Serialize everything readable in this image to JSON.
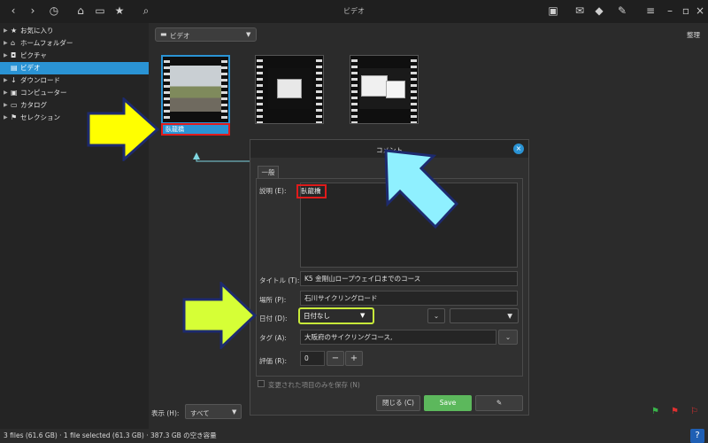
{
  "window": {
    "title": "ビデオ"
  },
  "sidebar": {
    "items": [
      {
        "label": "お気に入り",
        "icon": "star-icon",
        "glyph": "★"
      },
      {
        "label": "ホームフォルダー",
        "icon": "home-icon",
        "glyph": "⌂"
      },
      {
        "label": "ピクチャ",
        "icon": "camera-icon",
        "glyph": "◘"
      },
      {
        "label": "ビデオ",
        "icon": "film-icon",
        "glyph": "▤"
      },
      {
        "label": "ダウンロード",
        "icon": "download-icon",
        "glyph": "↓"
      },
      {
        "label": "コンピューター",
        "icon": "computer-icon",
        "glyph": "▣"
      },
      {
        "label": "カタログ",
        "icon": "catalog-icon",
        "glyph": "▭"
      },
      {
        "label": "セレクション",
        "icon": "flag-icon",
        "glyph": "⚑"
      }
    ],
    "selected_index": 3
  },
  "toolbar": {
    "path_label": "ビデオ",
    "sort_label": "整理"
  },
  "thumbnails": [
    {
      "caption": "臥龍橋"
    }
  ],
  "dialog": {
    "title": "コメント",
    "tab": "一般",
    "description_label": "説明 (E):",
    "description_value": "臥龍橋",
    "title_label": "タイトル (T):",
    "title_value": "K5 金剛山ロープウェイ口までのコース",
    "place_label": "場所 (P):",
    "place_value": "石川サイクリングロード",
    "date_label": "日付 (D):",
    "date_value": "日付なし",
    "tag_label": "タグ (A):",
    "tag_value": "大阪府のサイクリングコース,",
    "rating_label": "評価 (R):",
    "rating_value": "0",
    "save_modified_label": "変更された項目のみを保存 (N)",
    "close_label": "閉じる (C)",
    "save_label": "Save"
  },
  "footer": {
    "show_label": "表示 (H):",
    "show_value": "すべて",
    "status": "3 files (61.6 GB)  ·  1 file selected (61.3 GB)  ·  387.3 GB の空き容量"
  },
  "colors": {
    "accent": "#2a93d4",
    "highlight_red": "#e01b1b",
    "highlight_lime": "#c8ea3a",
    "arrow_yellow": "#ffff00",
    "arrow_lime": "#d6ff36",
    "arrow_cyan": "#8ff0ff",
    "save_green": "#5cb85c"
  }
}
